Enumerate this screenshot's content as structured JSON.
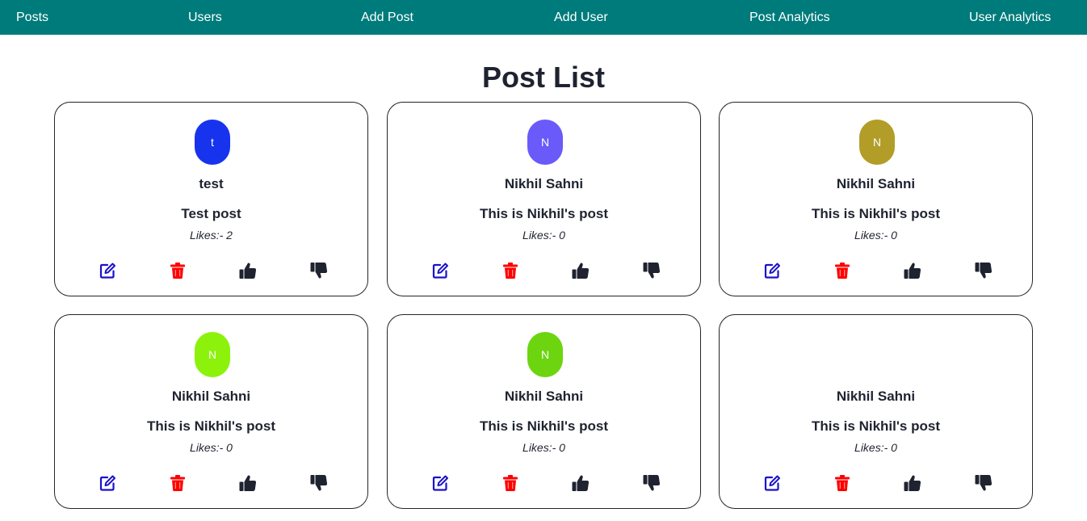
{
  "nav": {
    "links": [
      "Posts",
      "Users",
      "Add Post",
      "Add User",
      "Post Analytics",
      "User Analytics"
    ]
  },
  "page": {
    "title": "Post List"
  },
  "colors": {
    "nav_bg": "#007b7b",
    "edit_icon": "#1a12c9",
    "delete_icon": "#ff0000",
    "vote_icon": "#1f2330"
  },
  "posts": [
    {
      "avatar_letter": "t",
      "avatar_color": "#1733ee",
      "author": "test",
      "title": "Test post",
      "likes": "Likes:- 2"
    },
    {
      "avatar_letter": "N",
      "avatar_color": "#6a5af9",
      "author": "Nikhil Sahni",
      "title": "This is Nikhil's post",
      "likes": "Likes:- 0"
    },
    {
      "avatar_letter": "N",
      "avatar_color": "#b29d28",
      "author": "Nikhil Sahni",
      "title": "This is Nikhil's post",
      "likes": "Likes:- 0"
    },
    {
      "avatar_letter": "N",
      "avatar_color": "#8cf20c",
      "author": "Nikhil Sahni",
      "title": "This is Nikhil's post",
      "likes": "Likes:- 0"
    },
    {
      "avatar_letter": "N",
      "avatar_color": "#6cd510",
      "author": "Nikhil Sahni",
      "title": "This is Nikhil's post",
      "likes": "Likes:- 0"
    },
    {
      "avatar_letter": "",
      "avatar_color": "#ffffff",
      "author": "Nikhil Sahni",
      "title": "This is Nikhil's post",
      "likes": "Likes:- 0"
    }
  ]
}
